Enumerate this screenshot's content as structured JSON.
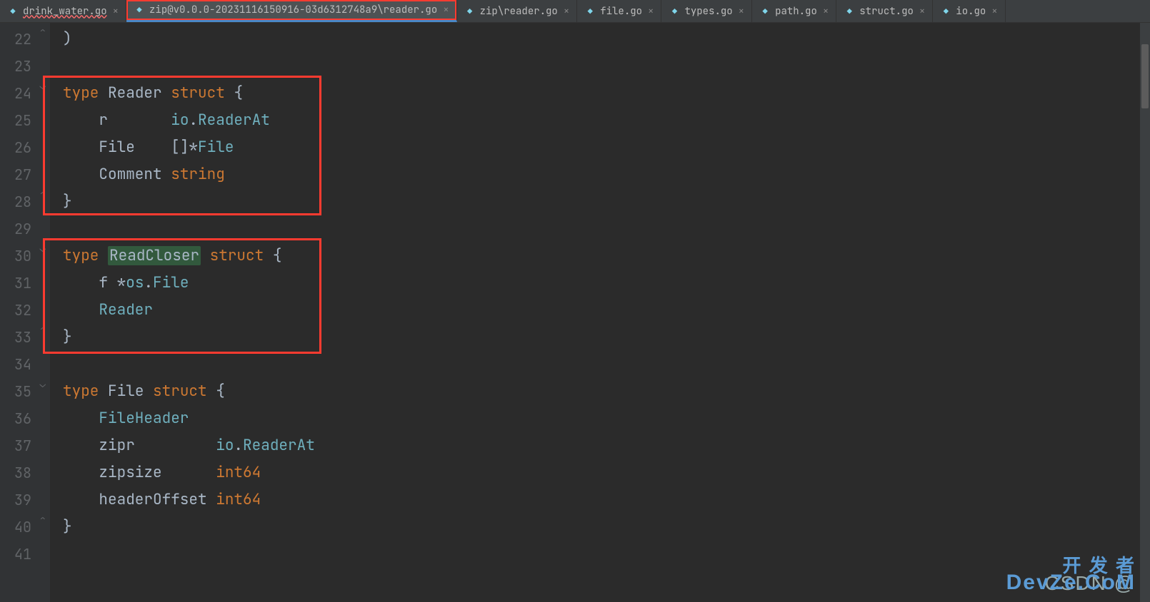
{
  "tabs": [
    {
      "label": "drink_water.go",
      "icon": "go",
      "active": false,
      "modified": true
    },
    {
      "label": "zip@v0.0.0-20231116150916-03d6312748a9\\reader.go",
      "icon": "go",
      "active": true,
      "modified": false
    },
    {
      "label": "zip\\reader.go",
      "icon": "go",
      "active": false,
      "modified": false
    },
    {
      "label": "file.go",
      "icon": "go",
      "active": false,
      "modified": false
    },
    {
      "label": "types.go",
      "icon": "go",
      "active": false,
      "modified": false
    },
    {
      "label": "path.go",
      "icon": "go",
      "active": false,
      "modified": false
    },
    {
      "label": "struct.go",
      "icon": "go",
      "active": false,
      "modified": false
    },
    {
      "label": "io.go",
      "icon": "go",
      "active": false,
      "modified": false
    }
  ],
  "lineNumbers": [
    "22",
    "23",
    "24",
    "25",
    "26",
    "27",
    "28",
    "29",
    "30",
    "31",
    "32",
    "33",
    "34",
    "35",
    "36",
    "37",
    "38",
    "39",
    "40",
    "41"
  ],
  "gutterIcons": {
    "line30": {
      "green": true,
      "arrow": "↑"
    }
  },
  "code": {
    "l22": {
      "brace": ")"
    },
    "l24": {
      "kw1": "type",
      "name": "Reader",
      "kw2": "struct",
      "brace": "{"
    },
    "l25": {
      "field": "r",
      "type1": "io",
      "dot": ".",
      "type2": "ReaderAt"
    },
    "l26": {
      "field": "File",
      "prefix": "[]*",
      "type": "File"
    },
    "l27": {
      "field": "Comment",
      "type": "string"
    },
    "l28": {
      "brace": "}"
    },
    "l30": {
      "kw1": "type",
      "name": "ReadCloser",
      "kw2": "struct",
      "brace": "{"
    },
    "l31": {
      "field": "f",
      "star": "*",
      "type1": "os",
      "dot": ".",
      "type2": "File"
    },
    "l32": {
      "type": "Reader"
    },
    "l33": {
      "brace": "}"
    },
    "l35": {
      "kw1": "type",
      "name": "File",
      "kw2": "struct",
      "brace": "{"
    },
    "l36": {
      "type": "FileHeader"
    },
    "l37": {
      "field": "zipr",
      "type1": "io",
      "dot": ".",
      "type2": "ReaderAt"
    },
    "l38": {
      "field": "zipsize",
      "type": "int64"
    },
    "l39": {
      "field": "headerOffset",
      "type": "int64"
    },
    "l40": {
      "brace": "}"
    }
  },
  "watermark": {
    "csdn": "CSDN @",
    "dev1": "开 发 者",
    "dev2": "DevZe.CoM"
  }
}
